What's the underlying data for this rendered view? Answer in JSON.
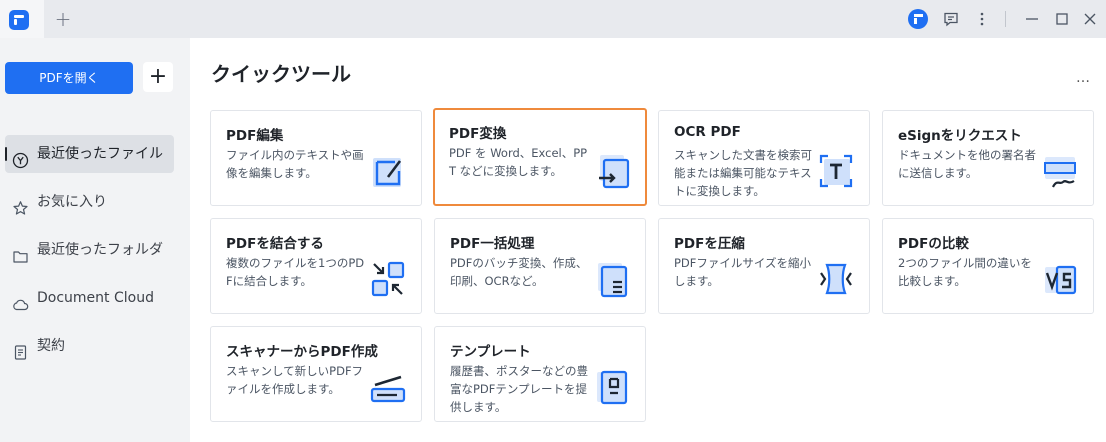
{
  "titlebar": {
    "new_tab": "+"
  },
  "sidebar": {
    "open_button": "PDFを開く",
    "add_button": "+",
    "items": [
      {
        "label": "最近使ったファイル",
        "icon": "clock-circle-icon",
        "active": true
      },
      {
        "label": "お気に入り",
        "icon": "star-icon",
        "active": false
      },
      {
        "label": "最近使ったフォルダ",
        "icon": "folder-icon",
        "active": false
      },
      {
        "label": "Document Cloud",
        "icon": "cloud-icon",
        "active": false
      },
      {
        "label": "契約",
        "icon": "contract-icon",
        "active": false
      }
    ]
  },
  "main": {
    "heading": "クイックツール",
    "more": "…",
    "tools": [
      {
        "title": "PDF編集",
        "desc": "ファイル内のテキストや画像を編集します。",
        "icon": "edit-document-icon"
      },
      {
        "title": "PDF変換",
        "desc": "PDF を Word、Excel、PPT などに変換します。",
        "icon": "convert-icon",
        "selected": true
      },
      {
        "title": "OCR PDF",
        "desc": "スキャンした文書を検索可能または編集可能なテキストに変換します。",
        "icon": "ocr-icon"
      },
      {
        "title": "eSignをリクエスト",
        "desc": "ドキュメントを他の署名者に送信します。",
        "icon": "signature-icon"
      },
      {
        "title": "PDFを結合する",
        "desc": "複数のファイルを1つのPDFに結合します。",
        "icon": "merge-icon"
      },
      {
        "title": "PDF一括処理",
        "desc": "PDFのバッチ変換、作成、印刷、OCRなど。",
        "icon": "batch-icon"
      },
      {
        "title": "PDFを圧縮",
        "desc": "PDFファイルサイズを縮小します。",
        "icon": "compress-icon"
      },
      {
        "title": "PDFの比較",
        "desc": "2つのファイル間の違いを比較します。",
        "icon": "compare-icon"
      },
      {
        "title": "スキャナーからPDF作成",
        "desc": "スキャンして新しいPDFファイルを作成します。",
        "icon": "scanner-icon"
      },
      {
        "title": "テンプレート",
        "desc": "履歴書、ポスターなどの豊富なPDFテンプレートを提供します。",
        "icon": "template-icon"
      }
    ]
  },
  "colors": {
    "accent": "#1f6ff2",
    "selected_border": "#ef8a3c",
    "sidebar_bg": "#f2f3f5"
  }
}
